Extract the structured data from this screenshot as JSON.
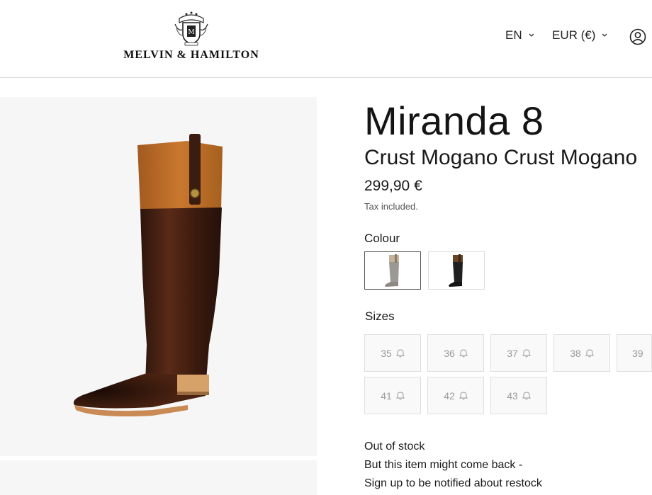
{
  "header": {
    "brand": "MELVIN & HAMILTON",
    "language": "EN",
    "currency": "EUR (€)"
  },
  "product": {
    "title": "Miranda 8",
    "subtitle": "Crust Mogano Crust Mogano",
    "price": "299,90 €",
    "tax_note": "Tax included."
  },
  "colour": {
    "label": "Colour",
    "options": [
      {
        "name": "grey-variant",
        "selected": true,
        "shaft_color": "#9c9894",
        "top_color": "#c3b39c"
      },
      {
        "name": "black-variant",
        "selected": false,
        "shaft_color": "#202020",
        "top_color": "#6a4424"
      }
    ]
  },
  "sizes": {
    "label": "Sizes",
    "options": [
      {
        "size": "35",
        "available": false
      },
      {
        "size": "36",
        "available": false
      },
      {
        "size": "37",
        "available": false
      },
      {
        "size": "38",
        "available": false
      },
      {
        "size": "39",
        "available": false
      },
      {
        "size": "41",
        "available": false
      },
      {
        "size": "42",
        "available": false
      },
      {
        "size": "43",
        "available": false
      }
    ]
  },
  "stock": {
    "status": "Out of stock",
    "line1": "But this item might come back -",
    "line2": "Sign up to be notified about restock"
  },
  "icons": {
    "account": "user-icon",
    "dropdown": "chevron-down-icon",
    "notify": "bell-icon"
  }
}
